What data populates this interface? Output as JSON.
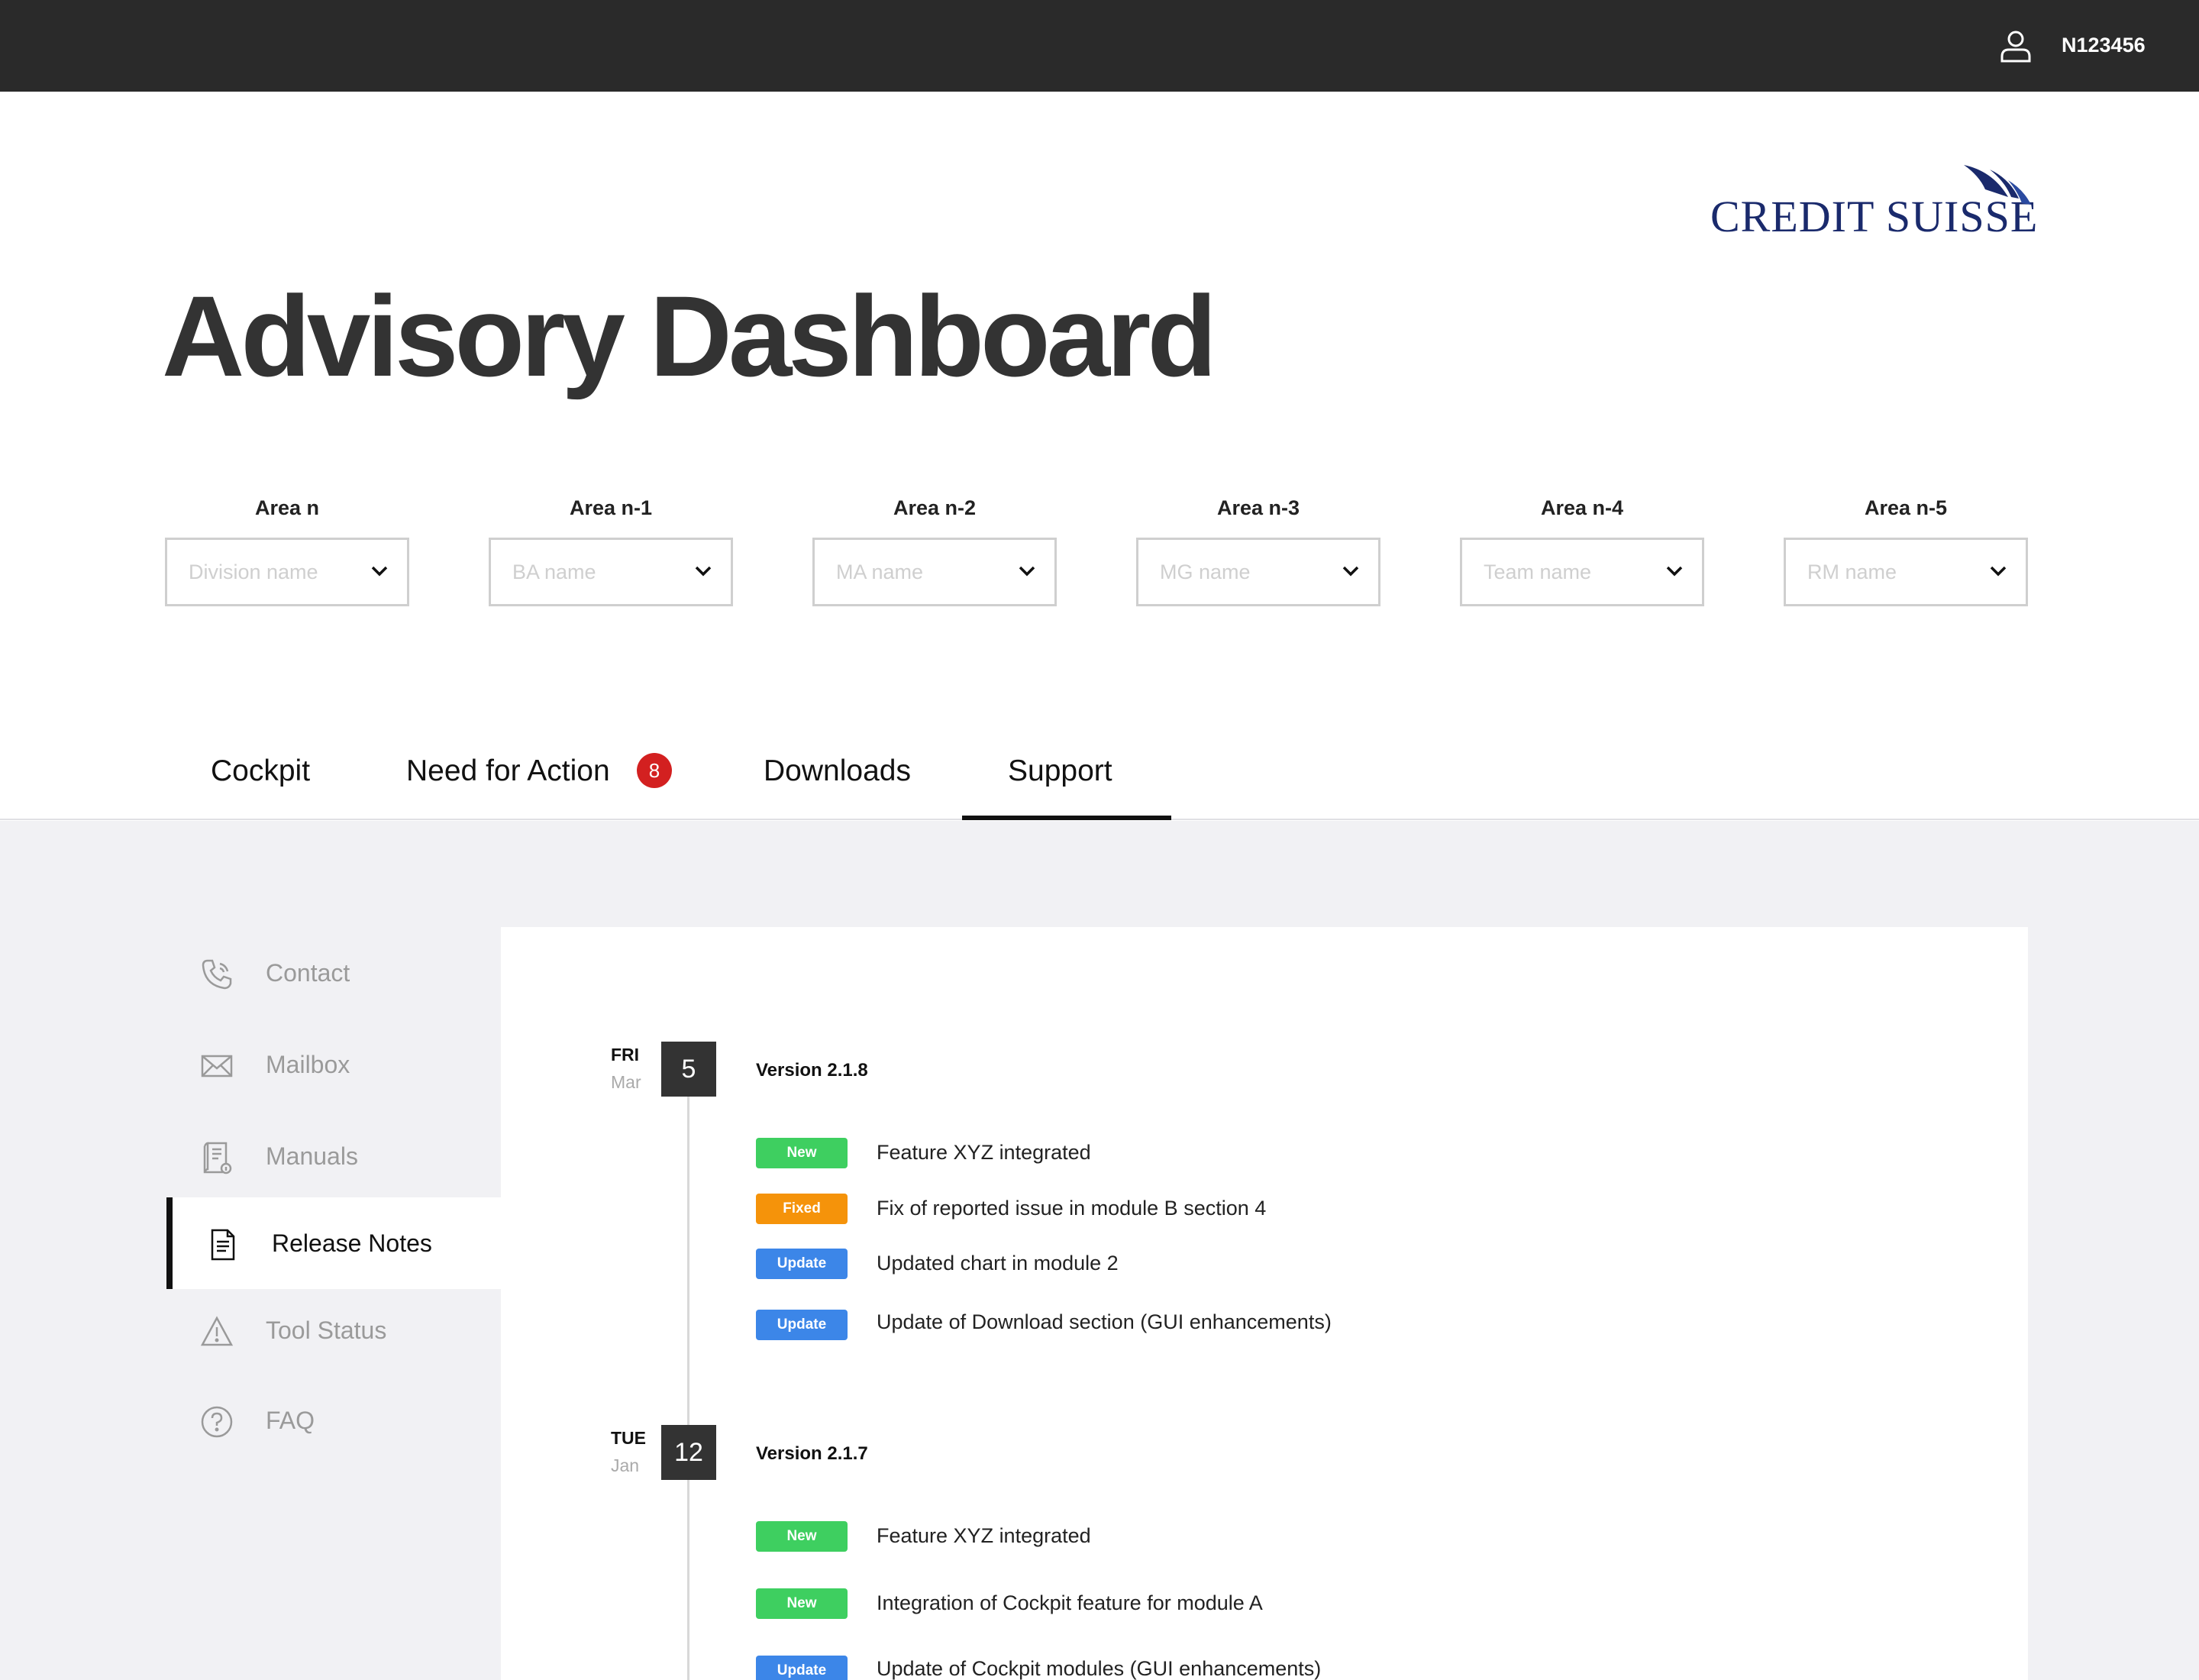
{
  "header": {
    "user_id": "N123456",
    "user_icon": "user-icon"
  },
  "brand": {
    "logo_text": "CREDIT SUISSE",
    "color": "#1a2a6c"
  },
  "page": {
    "title": "Advisory Dashboard"
  },
  "filters": [
    {
      "label": "Area n",
      "placeholder": "Division name"
    },
    {
      "label": "Area n-1",
      "placeholder": "BA name"
    },
    {
      "label": "Area n-2",
      "placeholder": "MA name"
    },
    {
      "label": "Area n-3",
      "placeholder": "MG name"
    },
    {
      "label": "Area n-4",
      "placeholder": "Team name"
    },
    {
      "label": "Area n-5",
      "placeholder": "RM name"
    }
  ],
  "tabs": [
    {
      "label": "Cockpit"
    },
    {
      "label": "Need for Action",
      "badge": "8"
    },
    {
      "label": "Downloads"
    },
    {
      "label": "Support",
      "active": true
    }
  ],
  "sidebar": {
    "items": [
      {
        "label": "Contact",
        "icon": "phone-icon"
      },
      {
        "label": "Mailbox",
        "icon": "mail-icon"
      },
      {
        "label": "Manuals",
        "icon": "manual-icon"
      },
      {
        "label": "Release Notes",
        "icon": "document-icon",
        "active": true
      },
      {
        "label": "Tool Status",
        "icon": "warning-icon"
      },
      {
        "label": "FAQ",
        "icon": "question-icon"
      }
    ]
  },
  "release_notes": [
    {
      "day": "FRI",
      "month": "Mar",
      "date": "5",
      "version": "Version 2.1.8",
      "entries": [
        {
          "tag": "New",
          "text": "Feature XYZ integrated"
        },
        {
          "tag": "Fixed",
          "text": "Fix of reported issue in module B section 4"
        },
        {
          "tag": "Update",
          "text": "Updated chart in module 2"
        },
        {
          "tag": "Update",
          "text": "Update of Download section (GUI enhancements)"
        }
      ]
    },
    {
      "day": "TUE",
      "month": "Jan",
      "date": "12",
      "version": "Version 2.1.7",
      "entries": [
        {
          "tag": "New",
          "text": "Feature XYZ integrated"
        },
        {
          "tag": "New",
          "text": "Integration of Cockpit feature for module A"
        },
        {
          "tag": "Update",
          "text": "Update of Cockpit modules (GUI enhancements)"
        }
      ]
    }
  ],
  "colors": {
    "tag_new": "#3ecf60",
    "tag_fixed": "#f5930a",
    "tag_update": "#3c86e8",
    "badge": "#d32020",
    "topbar": "#2a2a2a"
  }
}
